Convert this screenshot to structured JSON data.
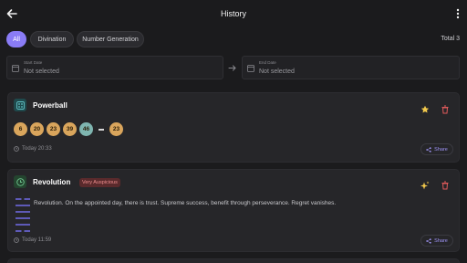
{
  "appbar": {
    "title": "History",
    "back_icon": "arrow-left-icon",
    "more_icon": "more-vertical-icon"
  },
  "filters": {
    "chips": [
      {
        "label": "All",
        "active": true
      },
      {
        "label": "Divination",
        "active": false
      },
      {
        "label": "Number Generation",
        "active": false
      }
    ],
    "total": "Total 3"
  },
  "date_range": {
    "start": {
      "label": "Start Date",
      "value": "Not selected"
    },
    "end": {
      "label": "End Date",
      "value": "Not selected"
    }
  },
  "cards": [
    {
      "type": "number_generation",
      "title": "Powerball",
      "icon": "dice-icon",
      "numbers": [
        "6",
        "20",
        "23",
        "39",
        "46"
      ],
      "bonus": "23",
      "time": "Today 20:33",
      "favorited": true,
      "share_label": "Share"
    },
    {
      "type": "divination",
      "title": "Revolution",
      "badge": "Very Auspicious",
      "icon": "clock-icon",
      "description": "Revolution. On the appointed day, there is trust. Supreme success, benefit through perseverance. Regret vanishes.",
      "time": "Today 11:59",
      "share_label": "Share"
    }
  ],
  "colors": {
    "accent": "#8a7cf6",
    "background": "#1b1b1d",
    "card": "#262629",
    "ball_gold": "#d9a55c",
    "ball_teal": "#7fb5b0",
    "delete": "#e05a5a",
    "star": "#f2c94c"
  }
}
